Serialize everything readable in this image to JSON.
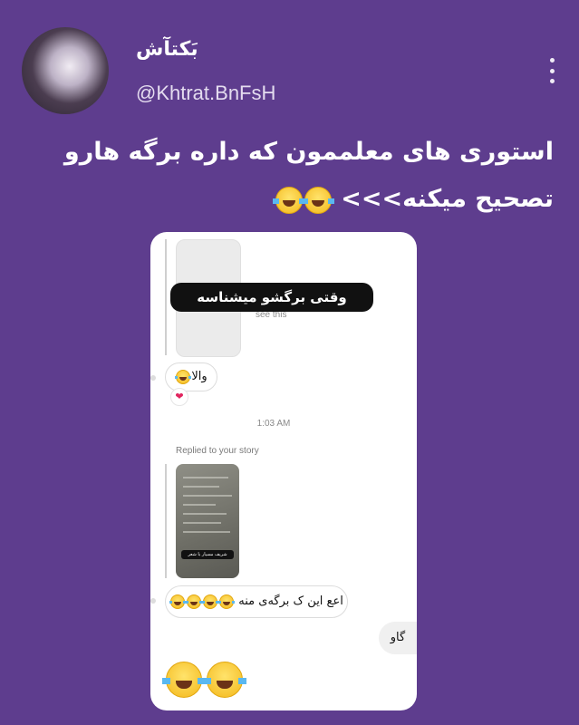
{
  "author": {
    "display_name": "بَکتآش",
    "handle": "@Khtrat.BnFsH"
  },
  "tweet": {
    "text": "استوری های معلممون که داره برگه هارو تصحیح میکنه>>>",
    "emojis": [
      "rolling-on-floor-laughing",
      "rolling-on-floor-laughing"
    ]
  },
  "screenshot": {
    "overlay_text": "وقتی برگشو میشناسه",
    "see_this": "see this",
    "bubble_1": {
      "text": "والا",
      "emoji": "rolling-on-floor-laughing"
    },
    "reaction": "❤",
    "timestamp": "1:03 AM",
    "replied_label": "Replied to your story",
    "story_caption": "شریف مسیار با شعر",
    "bubble_received": {
      "text": "اعع این ک برگه‌ی منه",
      "emojis": [
        "rolling-on-floor-laughing",
        "rolling-on-floor-laughing",
        "rolling-on-floor-laughing",
        "rolling-on-floor-laughing"
      ]
    },
    "bubble_sent": {
      "text": "گاو"
    },
    "big_emojis": [
      "rolling-on-floor-laughing",
      "rolling-on-floor-laughing"
    ]
  },
  "colors": {
    "background": "#5e3d8e",
    "text": "#ffffff",
    "bubble_sent": "#f0f0f0"
  }
}
